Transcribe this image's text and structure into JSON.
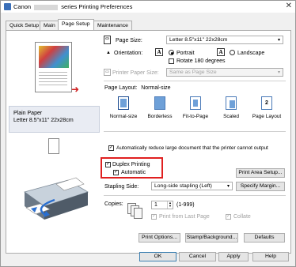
{
  "window": {
    "title_prefix": "Canon",
    "title_suffix": "series Printing Preferences",
    "close": "✕"
  },
  "tabs": [
    "Quick Setup",
    "Main",
    "Page Setup",
    "Maintenance"
  ],
  "preview": {
    "paper_name": "Plain Paper",
    "paper_desc": "Letter 8.5\"x11\" 22x28cm"
  },
  "page_size": {
    "label": "Page Size:",
    "value": "Letter 8.5\"x11\" 22x28cm"
  },
  "orientation": {
    "label": "Orientation:",
    "portrait": "Portrait",
    "landscape": "Landscape",
    "rotate": "Rotate 180 degrees",
    "portrait_glyph": "A",
    "landscape_glyph": "A"
  },
  "printer_paper_size": {
    "label": "Printer Paper Size:",
    "value": "Same as Page Size"
  },
  "page_layout": {
    "label": "Page Layout:",
    "value": "Normal-size",
    "options": [
      "Normal-size",
      "Borderless",
      "Fit-to-Page",
      "Scaled",
      "Page Layout"
    ]
  },
  "auto_reduce": "Automatically reduce large document that the printer cannot output",
  "duplex": {
    "label": "Duplex Printing",
    "automatic": "Automatic"
  },
  "print_area_button": "Print Area Setup...",
  "stapling": {
    "label": "Stapling Side:",
    "value": "Long-side stapling (Left)"
  },
  "specify_margin_button": "Specify Margin...",
  "copies": {
    "label": "Copies:",
    "value": "1",
    "range": "(1-999)",
    "print_from_last": "Print from Last Page",
    "collate": "Collate"
  },
  "bottom_buttons": {
    "print_options": "Print Options...",
    "stamp_background": "Stamp/Background...",
    "defaults": "Defaults"
  },
  "dialog_buttons": {
    "ok": "OK",
    "cancel": "Cancel",
    "apply": "Apply",
    "help": "Help"
  },
  "colors": {
    "accent_red": "#e02020",
    "selection_blue": "#3c7fb1"
  }
}
